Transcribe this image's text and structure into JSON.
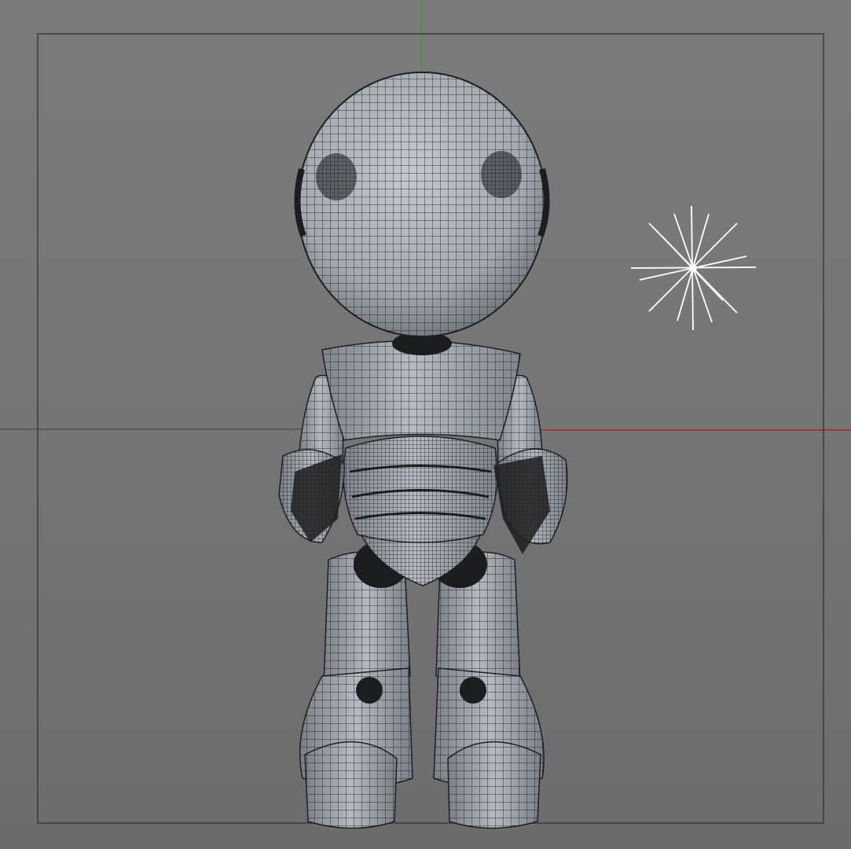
{
  "viewport": {
    "view": "perspective-front",
    "background_color": "#777777",
    "render_mode": "wireframe-on-shaded"
  },
  "axes": {
    "x_axis_color": "#b02a20",
    "y_axis_color": "#3e9a2c",
    "horizon_color": "#555555"
  },
  "safe_frame": {
    "visible": true,
    "color": "#3a3a3a"
  },
  "model": {
    "name": "robot-character",
    "surface_color": "#a7adb5",
    "shadow_color": "#1c1d1f",
    "wire_color": "#1e1f22"
  },
  "light": {
    "type": "omni-light",
    "icon": "starburst-icon",
    "color": "#ffffff"
  }
}
